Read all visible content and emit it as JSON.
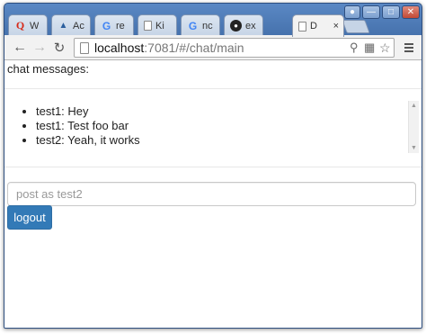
{
  "browser": {
    "tabs": [
      {
        "title": "W",
        "icon": "quora-icon",
        "active": false
      },
      {
        "title": "Ac",
        "icon": "account-icon",
        "active": false
      },
      {
        "title": "re",
        "icon": "google-icon",
        "active": false
      },
      {
        "title": "Ki",
        "icon": "document-icon",
        "active": false
      },
      {
        "title": "nc",
        "icon": "google-icon",
        "active": false
      },
      {
        "title": "ex",
        "icon": "github-icon",
        "active": false
      },
      {
        "title": "D",
        "icon": "document-icon",
        "active": true
      }
    ],
    "close_glyph": "×",
    "url_host": "localhost",
    "url_path": ":7081/#/chat/main"
  },
  "page": {
    "heading": "chat messages:",
    "messages": [
      "test1: Hey",
      "test1: Test foo bar",
      "test2: Yeah, it works"
    ],
    "post_placeholder": "post as test2",
    "post_value": "",
    "logout_label": "logout"
  },
  "colors": {
    "primary_button": "#337ab7",
    "frame": "#4d7bb8"
  }
}
